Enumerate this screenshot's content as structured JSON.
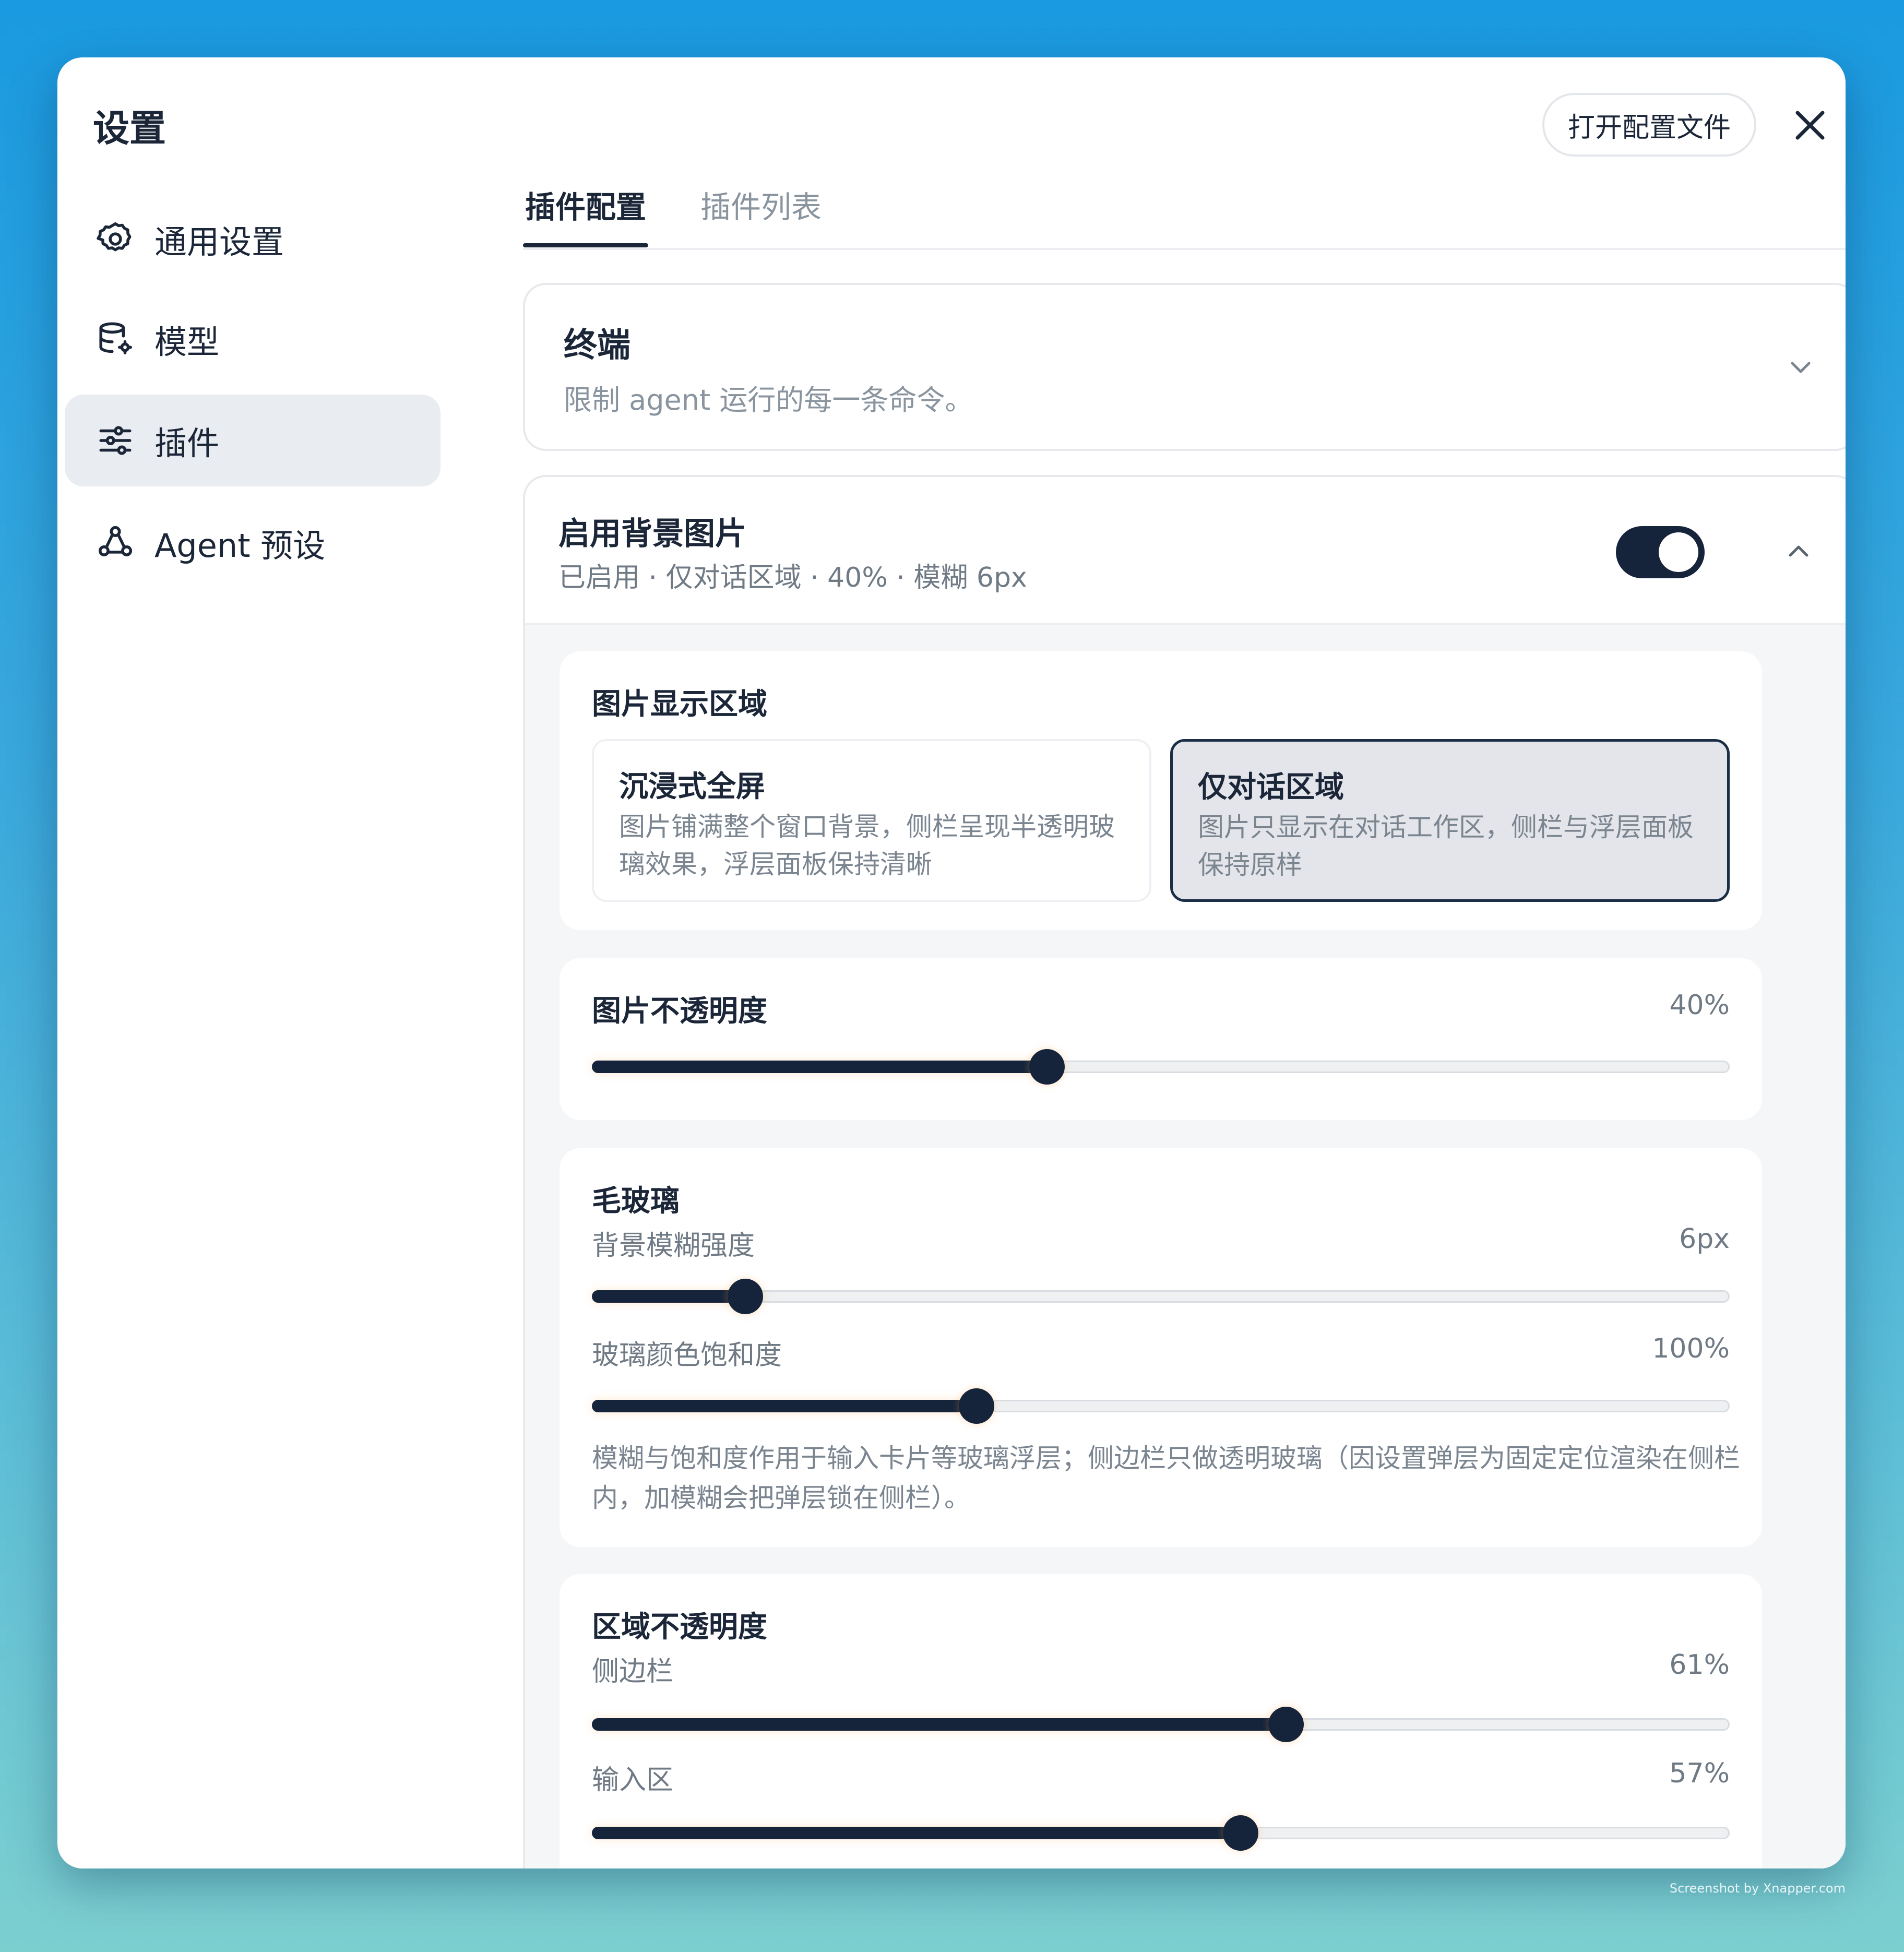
{
  "window": {
    "title": "设置",
    "open_config_label": "打开配置文件"
  },
  "sidebar": {
    "items": [
      {
        "label": "通用设置",
        "icon": "gear-icon"
      },
      {
        "label": "模型",
        "icon": "database-gear-icon"
      },
      {
        "label": "插件",
        "icon": "sliders-icon",
        "active": true
      },
      {
        "label": "Agent 预设",
        "icon": "agent-nodes-icon"
      }
    ]
  },
  "tabs": [
    {
      "label": "插件配置",
      "active": true
    },
    {
      "label": "插件列表",
      "active": false
    }
  ],
  "terminal_card": {
    "title": "终端",
    "description": "限制 agent 运行的每一条命令。"
  },
  "background_card": {
    "title": "启用背景图片",
    "summary": "已启用 · 仅对话区域 · 40% · 模糊 6px",
    "enabled": true,
    "display_area": {
      "title": "图片显示区域",
      "options": [
        {
          "title": "沉浸式全屏",
          "desc": "图片铺满整个窗口背景，侧栏呈现半透明玻璃效果，浮层面板保持清晰",
          "selected": false
        },
        {
          "title": "仅对话区域",
          "desc": "图片只显示在对话工作区，侧栏与浮层面板保持原样",
          "selected": true
        }
      ]
    },
    "image_opacity": {
      "title": "图片不透明度",
      "value_label": "40%",
      "value": 0.4
    },
    "frosted_glass": {
      "title": "毛玻璃",
      "blur": {
        "label": "背景模糊强度",
        "value_label": "6px",
        "value": 0.135
      },
      "saturation": {
        "label": "玻璃颜色饱和度",
        "value_label": "100%",
        "value": 0.338
      },
      "note": "模糊与饱和度作用于输入卡片等玻璃浮层；侧边栏只做透明玻璃（因设置弹层为固定定位渲染在侧栏内，加模糊会把弹层锁在侧栏）。"
    },
    "region_opacity": {
      "title": "区域不透明度",
      "sidebar": {
        "label": "侧边栏",
        "value_label": "61%",
        "value": 0.61
      },
      "input": {
        "label": "输入区",
        "value_label": "57%",
        "value": 0.57
      }
    }
  },
  "watermark": "Screenshot by Xnapper.com",
  "colors": {
    "accent": "#15243a",
    "muted_text": "#8a949f",
    "background_top": "#1a9ae0",
    "background_bottom": "#7ccfcf"
  }
}
